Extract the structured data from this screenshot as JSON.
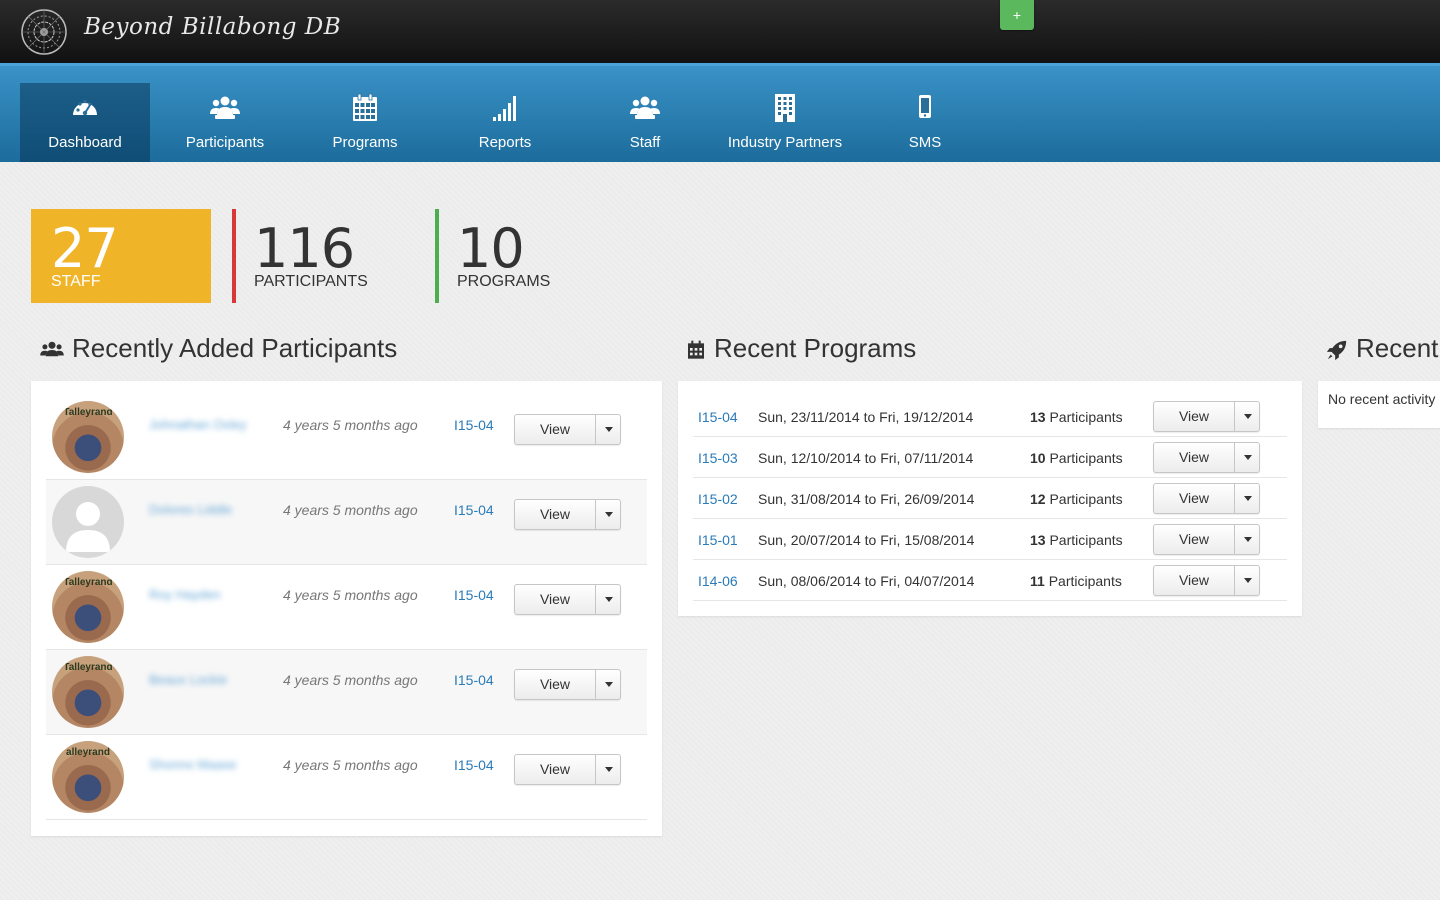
{
  "app": {
    "title": "Beyond Billabong DB",
    "add_button": "+"
  },
  "nav": {
    "items": [
      {
        "label": "Dashboard",
        "icon": "dashboard-icon",
        "active": true
      },
      {
        "label": "Participants",
        "icon": "users-icon"
      },
      {
        "label": "Programs",
        "icon": "calendar-icon"
      },
      {
        "label": "Reports",
        "icon": "signal-bars-icon"
      },
      {
        "label": "Staff",
        "icon": "users-icon"
      },
      {
        "label": "Industry Partners",
        "icon": "building-icon"
      },
      {
        "label": "SMS",
        "icon": "mobile-icon"
      }
    ]
  },
  "stats": {
    "staff": {
      "value": "27",
      "label": "STAFF",
      "color": "#f0b429"
    },
    "participants": {
      "value": "116",
      "label": "PARTICIPANTS",
      "color": "#d9383a"
    },
    "programs": {
      "value": "10",
      "label": "PROGRAMS",
      "color": "#4cae4c"
    }
  },
  "recent_participants": {
    "title": "Recently Added Participants",
    "rows": [
      {
        "name": "Johnathan Oxley",
        "time": "4 years 5 months ago",
        "program": "I15-04",
        "view_label": "View",
        "avatar_text": "Talleyrand"
      },
      {
        "name": "Dolores Liddle",
        "time": "4 years 5 months ago",
        "program": "I15-04",
        "view_label": "View",
        "avatar_text": ""
      },
      {
        "name": "Roy Hayden",
        "time": "4 years 5 months ago",
        "program": "I15-04",
        "view_label": "View",
        "avatar_text": "Talleyrand"
      },
      {
        "name": "Beaux Lockie",
        "time": "4 years 5 months ago",
        "program": "I15-04",
        "view_label": "View",
        "avatar_text": "Talleyrand"
      },
      {
        "name": "Shonno Maase",
        "time": "4 years 5 months ago",
        "program": "I15-04",
        "view_label": "View",
        "avatar_text": "alleyrand"
      }
    ]
  },
  "recent_programs": {
    "title": "Recent Programs",
    "rows": [
      {
        "code": "I15-04",
        "dates": "Sun, 23/11/2014 to Fri, 19/12/2014",
        "count": "13",
        "count_label": "Participants",
        "view_label": "View"
      },
      {
        "code": "I15-03",
        "dates": "Sun, 12/10/2014 to Fri, 07/11/2014",
        "count": "10",
        "count_label": "Participants",
        "view_label": "View"
      },
      {
        "code": "I15-02",
        "dates": "Sun, 31/08/2014 to Fri, 26/09/2014",
        "count": "12",
        "count_label": "Participants",
        "view_label": "View"
      },
      {
        "code": "I15-01",
        "dates": "Sun, 20/07/2014 to Fri, 15/08/2014",
        "count": "13",
        "count_label": "Participants",
        "view_label": "View"
      },
      {
        "code": "I14-06",
        "dates": "Sun, 08/06/2014 to Fri, 04/07/2014",
        "count": "11",
        "count_label": "Participants",
        "view_label": "View"
      }
    ]
  },
  "recent_activity": {
    "title": "Recent",
    "empty_text": "No recent activity"
  }
}
